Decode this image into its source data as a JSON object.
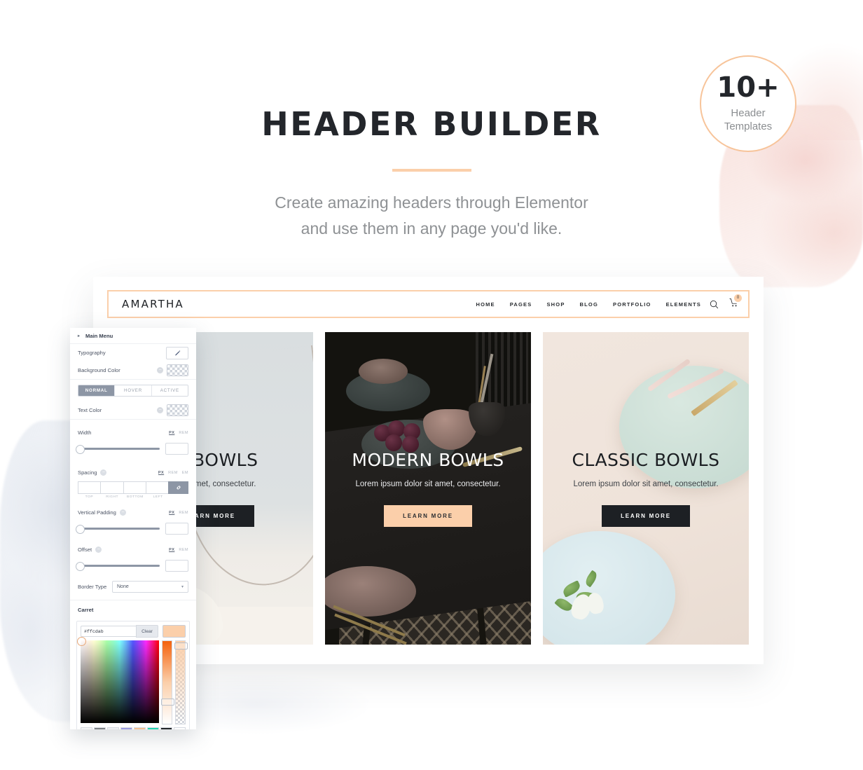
{
  "hero": {
    "title": "HEADER BUILDER",
    "subtitle_line1": "Create amazing headers through Elementor",
    "subtitle_line2": "and use them in any page you'd like.",
    "accent_color": "#fbcfaa"
  },
  "badge": {
    "count": "10+",
    "line1": "Header",
    "line2": "Templates",
    "border_color": "#f7c49a"
  },
  "mockup": {
    "navbar": {
      "logo": "AMARTHA",
      "menu": [
        "HOME",
        "PAGES",
        "SHOP",
        "BLOG",
        "PORTFOLIO",
        "ELEMENTS"
      ],
      "search_icon": "search-icon",
      "cart_icon": "cart-icon",
      "cart_count": "0",
      "border_color": "#fbcfaa"
    },
    "cards": [
      {
        "title": "UE BOWLS",
        "subtitle": "olor sit amet, consectetur.",
        "button": "LEARN MORE",
        "button_style": "dark"
      },
      {
        "title": "MODERN BOWLS",
        "subtitle": "Lorem ipsum dolor sit amet, consectetur.",
        "button": "LEARN MORE",
        "button_style": "peach"
      },
      {
        "title": "CLASSIC BOWLS",
        "subtitle": "Lorem ipsum dolor sit amet, consectetur.",
        "button": "LEARN MORE",
        "button_style": "dark"
      }
    ]
  },
  "panel": {
    "section_title": "Main Menu",
    "typography_label": "Typography",
    "background_color_label": "Background Color",
    "state_tabs": [
      "NORMAL",
      "HOVER",
      "ACTIVE"
    ],
    "active_state_tab": "NORMAL",
    "text_color_label": "Text Color",
    "width_label": "Width",
    "width_units": [
      "PX",
      "REM"
    ],
    "width_unit_active": "PX",
    "width_value": "",
    "spacing_label": "Spacing",
    "spacing_units": [
      "PX",
      "REM",
      "EM"
    ],
    "spacing_unit_active": "PX",
    "spacing_sides": [
      "TOP",
      "RIGHT",
      "BOTTOM",
      "LEFT"
    ],
    "spacing_values": [
      "",
      "",
      "",
      ""
    ],
    "link_icon": "link-icon",
    "vertical_padding_label": "Vertical Padding",
    "vertical_padding_units": [
      "PX",
      "REM"
    ],
    "vertical_padding_unit_active": "PX",
    "vertical_padding_value": "",
    "offset_label": "Offset",
    "offset_units": [
      "PX",
      "REM"
    ],
    "offset_unit_active": "PX",
    "offset_value": "",
    "border_type_label": "Border Type",
    "border_type_value": "None",
    "carret_label": "Carret",
    "picker": {
      "hex_value": "#ffcdab",
      "clear_label": "Clear",
      "preview_color": "#fbcfaa",
      "swatches": [
        "#f4f5f6",
        "#7d8084",
        "#eef0f2",
        "#9c9ce0",
        "#f5c192",
        "#1fd5b0",
        "#22262a",
        "#ffffff"
      ],
      "alpha_swatch": "alpha-checker"
    }
  }
}
